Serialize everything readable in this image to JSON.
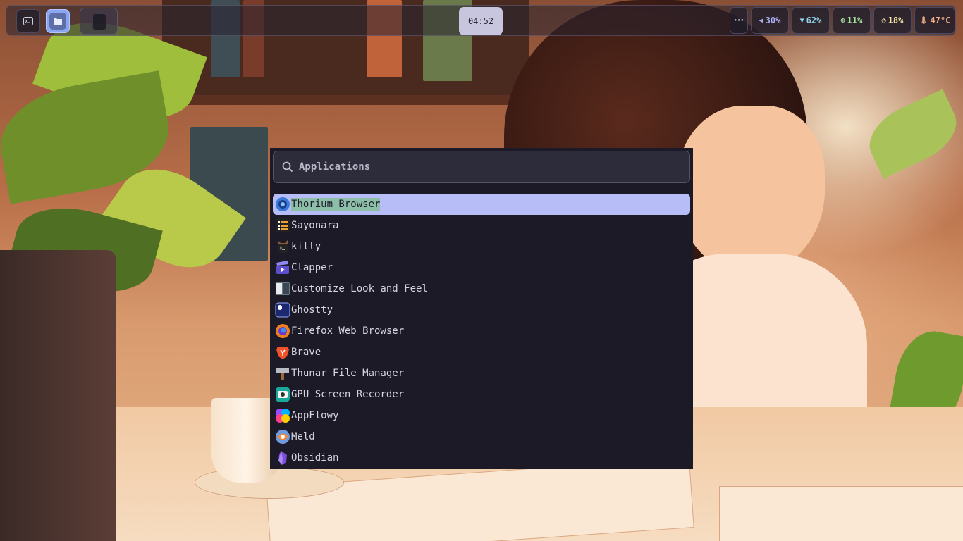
{
  "topbar": {
    "clock": "04:52",
    "stats": {
      "idle_icon": "zzz",
      "volume": "30%",
      "wifi": "62%",
      "cpu": "11%",
      "memory": "18%",
      "temperature": "47°C"
    },
    "colors": {
      "volume": "#aab0f5",
      "wifi": "#8fd3f0",
      "cpu": "#a7e3a0",
      "memory": "#f3e3a6",
      "temperature": "#f2b08a"
    }
  },
  "launcher": {
    "placeholder": "Applications",
    "selected_index": 0,
    "apps": [
      {
        "label": "Thorium Browser",
        "icon": "thorium-icon"
      },
      {
        "label": "Sayonara",
        "icon": "sayonara-icon"
      },
      {
        "label": "kitty",
        "icon": "kitty-icon"
      },
      {
        "label": "Clapper",
        "icon": "clapper-icon"
      },
      {
        "label": "Customize Look and Feel",
        "icon": "appearance-icon"
      },
      {
        "label": "Ghostty",
        "icon": "ghostty-icon"
      },
      {
        "label": "Firefox Web Browser",
        "icon": "firefox-icon"
      },
      {
        "label": "Brave",
        "icon": "brave-icon"
      },
      {
        "label": "Thunar File Manager",
        "icon": "thunar-icon"
      },
      {
        "label": "GPU Screen Recorder",
        "icon": "gpu-recorder-icon"
      },
      {
        "label": "AppFlowy",
        "icon": "appflowy-icon"
      },
      {
        "label": "Meld",
        "icon": "meld-icon"
      },
      {
        "label": "Obsidian",
        "icon": "obsidian-icon"
      }
    ]
  }
}
